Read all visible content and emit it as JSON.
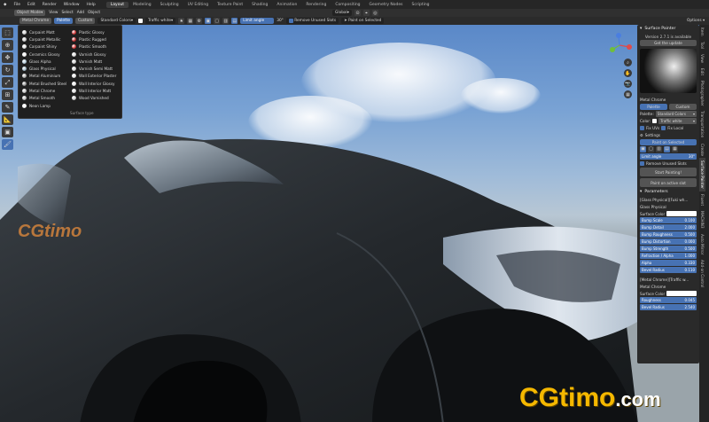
{
  "topbar": {
    "menus": [
      "File",
      "Edit",
      "Render",
      "Window",
      "Help"
    ],
    "workspaces": [
      "Layout",
      "Modeling",
      "Sculpting",
      "UV Editing",
      "Texture Paint",
      "Shading",
      "Animation",
      "Rendering",
      "Compositing",
      "Geometry Nodes",
      "Scripting"
    ],
    "active_ws": "Layout"
  },
  "header": {
    "mode": "Object Mode",
    "items": [
      "View",
      "Select",
      "Add",
      "Object"
    ],
    "transform": "Global"
  },
  "toolbar": {
    "material": "Metal Chrome",
    "palette": "Palette",
    "custom": "Custom",
    "colors": "Standard Colors",
    "color_name": "Traffic white",
    "limit_angle": "Limit angle",
    "angle": "30°",
    "remove_slots": "Remove Unused Slots",
    "paint_selected": "Paint on Selected",
    "options": "Options"
  },
  "menu": {
    "col1": [
      {
        "label": "Carpaint Matt",
        "c": "#d0d0d0"
      },
      {
        "label": "Carpaint Metallic",
        "c": "#c8c8c8"
      },
      {
        "label": "Carpaint Shiny",
        "c": "#e0e0e0"
      },
      {
        "label": "Ceramics Glossy",
        "c": "#f0f0f0"
      },
      {
        "label": "Glass Alpha",
        "c": "#b0c8d8"
      },
      {
        "label": "Glass Physical",
        "c": "#a0b8c8"
      },
      {
        "label": "Metal Aluminium",
        "c": "#a8a8a8"
      },
      {
        "label": "Metal Brushed Steel",
        "c": "#909090"
      },
      {
        "label": "Metal Chrome",
        "c": "#c0c0c0"
      },
      {
        "label": "Metal Smooth",
        "c": "#b8b8b8"
      },
      {
        "label": "Neon Lamp",
        "c": "#f8f8f8"
      }
    ],
    "col2": [
      {
        "label": "Plastic Glossy",
        "c": "#cc2a2a"
      },
      {
        "label": "Plastic Rugged",
        "c": "#b82222"
      },
      {
        "label": "Plastic Smooth",
        "c": "#d03030"
      },
      {
        "label": "Varnish Glossy",
        "c": "#d8d8d8"
      },
      {
        "label": "Varnish Matt",
        "c": "#cfcfcf"
      },
      {
        "label": "Varnish Semi Matt",
        "c": "#d4d4d4"
      },
      {
        "label": "Wall Exterior Plaster",
        "c": "#e4e4e4"
      },
      {
        "label": "Wall Interior Glossy",
        "c": "#e8e8e8"
      },
      {
        "label": "Wall Interior Matt",
        "c": "#dedede"
      },
      {
        "label": "Wood Varnished",
        "c": "#c9c9c9"
      }
    ],
    "footer": "Surface type"
  },
  "npanel": {
    "title": "Surface Painter",
    "version": "Version 2.7.1 is available",
    "get_update": "Get the update",
    "material": "Metal Chrome",
    "palette": "Palette",
    "custom": "Custom",
    "palette_label": "Palette:",
    "palette_value": "Standard Colors",
    "color_label": "Color:",
    "color_value": "Traffic white",
    "fix_uvs": "Fix UVs",
    "fix_local": "Fix Local",
    "settings": "Settings",
    "paint_selected": "Paint on Selected",
    "limit_angle": "Limit angle",
    "angle": "30°",
    "remove_slots": "Remove Unused Slots",
    "start_painting": "Start Painting!",
    "paint_active": "Paint on active slot",
    "parameters": "Parameters",
    "block1": {
      "title": "[Glass Physical][Fuki wh...",
      "sub": "Glass Physical",
      "color_label": "Surface Color",
      "rows": [
        {
          "k": "Bump Scale",
          "v": "0.100"
        },
        {
          "k": "Bump Detail",
          "v": "2.000"
        },
        {
          "k": "Bump Roughness",
          "v": "0.500"
        },
        {
          "k": "Bump Distortion",
          "v": "0.000"
        },
        {
          "k": "Bump Strength",
          "v": "0.500"
        },
        {
          "k": "Refraction / Alpha",
          "v": "1.000"
        },
        {
          "k": "Alpha",
          "v": "0.330"
        },
        {
          "k": "Bevel Radius",
          "v": "0.110"
        }
      ]
    },
    "block2": {
      "title": "[Metal Chrome][Traffic w...",
      "sub": "Metal Chrome",
      "color_label": "Surface Color",
      "rows": [
        {
          "k": "Roughness",
          "v": "0.045"
        },
        {
          "k": "Bevel Radius",
          "v": "2.540"
        }
      ]
    }
  },
  "tabs": [
    "Item",
    "Tool",
    "View",
    "Edit",
    "Photographer",
    "Transportation",
    "Create",
    "Surface Painter",
    "Fluent",
    "MACHIN3",
    "Auto Mirror",
    "Add-on Control"
  ],
  "active_tab": "Surface Painter",
  "logo": {
    "text": "CGtimo",
    "suffix": ".com"
  },
  "watermark": "CGtimo"
}
